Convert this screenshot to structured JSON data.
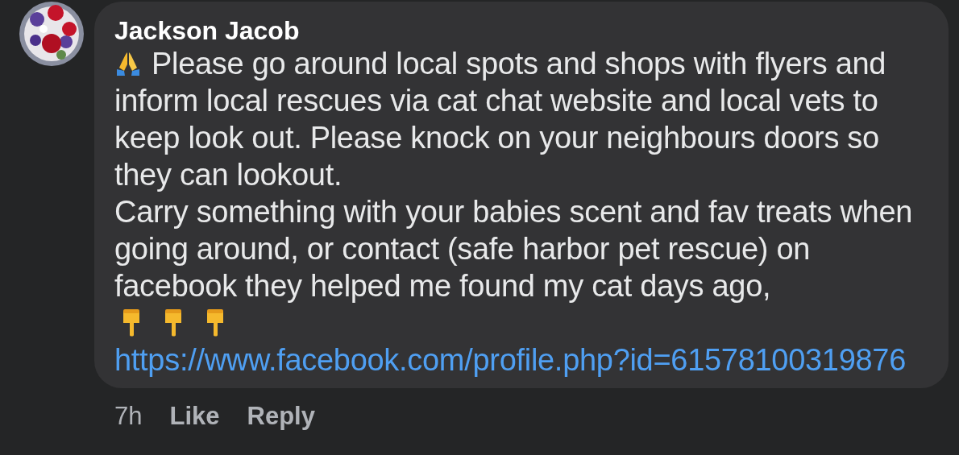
{
  "comment": {
    "author": "Jackson Jacob",
    "lines": [
      {
        "kind": "prayer",
        "text": "Please go around local spots and shops with flyers and"
      },
      {
        "kind": "text",
        "text": "inform local rescues via cat chat website and local vets to"
      },
      {
        "kind": "text",
        "text": "keep look out. Please knock on your neighbours doors so"
      },
      {
        "kind": "text",
        "text": "they can lookout."
      },
      {
        "kind": "text",
        "text": "Carry something with your babies scent and fav treats when"
      },
      {
        "kind": "text",
        "text": "going around, or contact (safe harbor pet rescue) on"
      },
      {
        "kind": "text",
        "text": "facebook they helped me found my cat days ago,"
      },
      {
        "kind": "pointers"
      },
      {
        "kind": "link",
        "text": "https://www.facebook.com/profile.php?id=61578100319876"
      }
    ],
    "time": "7h",
    "actions": [
      "Like",
      "Reply"
    ]
  }
}
